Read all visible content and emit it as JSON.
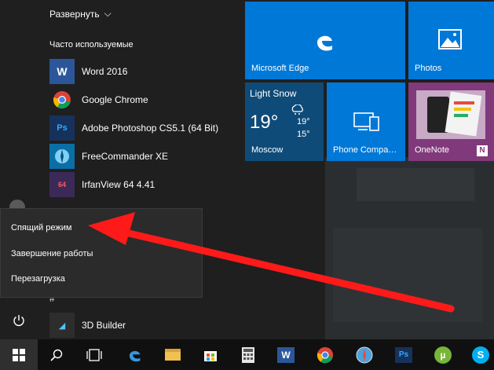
{
  "start_menu": {
    "expand_label": "Развернуть",
    "most_used_title": "Часто используемые",
    "apps": [
      {
        "label": "Word 2016",
        "icon": "word-icon",
        "icon_text": "W",
        "color": "#2b579a"
      },
      {
        "label": "Google Chrome",
        "icon": "chrome-icon",
        "icon_text": "",
        "color": "#1f1f1f"
      },
      {
        "label": "Adobe Photoshop CS5.1 (64 Bit)",
        "icon": "photoshop-icon",
        "icon_text": "Ps",
        "color": "#16325c"
      },
      {
        "label": "FreeCommander XE",
        "icon": "freecommander-icon",
        "icon_text": "",
        "color": "#0b6fa6"
      },
      {
        "label": "IrfanView 64 4.41",
        "icon": "irfanview-icon",
        "icon_text": "64",
        "color": "#3b2a58"
      }
    ],
    "section_hash": "#",
    "builder_label": "3D Builder"
  },
  "tiles": {
    "edge": {
      "label": "Microsoft Edge",
      "color": "#0078d7"
    },
    "photos": {
      "label": "Photos",
      "color": "#0078d7"
    },
    "weather": {
      "condition": "Light Snow",
      "temp_main": "19°",
      "temp_high": "19°",
      "temp_low": "15°",
      "city": "Moscow",
      "color": "#0f4b78"
    },
    "phone": {
      "label": "Phone Compa…",
      "color": "#0078d7"
    },
    "onenote": {
      "label": "OneNote",
      "color": "#80397b"
    }
  },
  "power_menu": {
    "items": [
      "Спящий режим",
      "Завершение работы",
      "Перезагрузка"
    ]
  },
  "taskbar": {
    "apps": [
      "windows-start-icon",
      "search-icon",
      "task-view-icon",
      "edge-icon",
      "explorer-icon",
      "store-icon",
      "calculator-icon",
      "word-icon",
      "chrome-icon",
      "safari-icon",
      "photoshop-icon",
      "utorrent-icon",
      "skype-icon"
    ]
  },
  "annotation": {
    "arrow_color": "#ff1a1a"
  }
}
